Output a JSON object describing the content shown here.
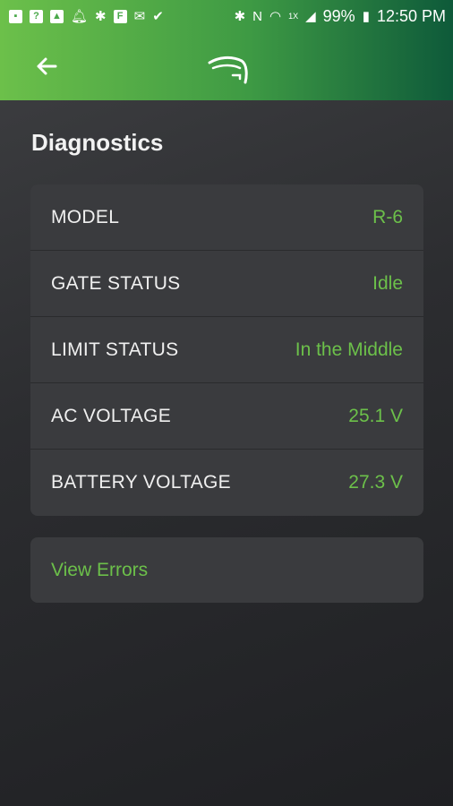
{
  "status_bar": {
    "battery": "99%",
    "time": "12:50 PM",
    "network_badge": "1X"
  },
  "header": {
    "back_icon": "arrow-left-icon",
    "logo_icon": "brand-logo-icon"
  },
  "page": {
    "title": "Diagnostics"
  },
  "diagnostics": [
    {
      "label": "MODEL",
      "value": "R-6"
    },
    {
      "label": "GATE STATUS",
      "value": "Idle"
    },
    {
      "label": "LIMIT STATUS",
      "value": "In the Middle"
    },
    {
      "label": "AC VOLTAGE",
      "value": "25.1 V"
    },
    {
      "label": "BATTERY VOLTAGE",
      "value": "27.3 V"
    }
  ],
  "errors_button": {
    "label": "View Errors"
  },
  "colors": {
    "accent": "#6cc04a",
    "header_start": "#6cc04a",
    "header_end": "#0e5a3a",
    "card": "#3a3b3e"
  }
}
